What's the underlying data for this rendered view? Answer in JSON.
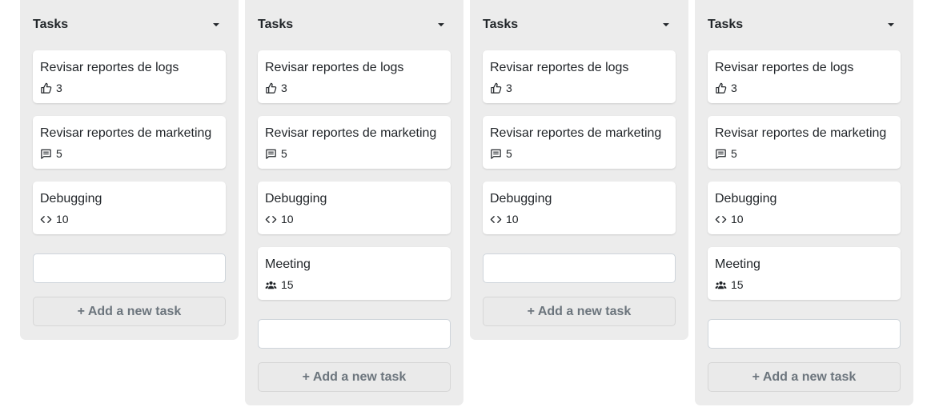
{
  "columns": [
    {
      "title": "Tasks",
      "input_value": "",
      "add_label": "+ Add a new task",
      "cards": [
        {
          "title": "Revisar reportes de logs",
          "icon": "thumbs-up-icon",
          "count": "3"
        },
        {
          "title": "Revisar reportes de marketing",
          "icon": "comment-icon",
          "count": "5"
        },
        {
          "title": "Debugging",
          "icon": "code-icon",
          "count": "10"
        }
      ]
    },
    {
      "title": "Tasks",
      "input_value": "",
      "add_label": "+ Add a new task",
      "cards": [
        {
          "title": "Revisar reportes de logs",
          "icon": "thumbs-up-icon",
          "count": "3"
        },
        {
          "title": "Revisar reportes de marketing",
          "icon": "comment-icon",
          "count": "5"
        },
        {
          "title": "Debugging",
          "icon": "code-icon",
          "count": "10"
        },
        {
          "title": "Meeting",
          "icon": "people-icon",
          "count": "15"
        }
      ]
    },
    {
      "title": "Tasks",
      "input_value": "",
      "add_label": "+ Add a new task",
      "cards": [
        {
          "title": "Revisar reportes de logs",
          "icon": "thumbs-up-icon",
          "count": "3"
        },
        {
          "title": "Revisar reportes de marketing",
          "icon": "comment-icon",
          "count": "5"
        },
        {
          "title": "Debugging",
          "icon": "code-icon",
          "count": "10"
        }
      ]
    },
    {
      "title": "Tasks",
      "input_value": "",
      "add_label": "+ Add a new task",
      "cards": [
        {
          "title": "Revisar reportes de logs",
          "icon": "thumbs-up-icon",
          "count": "3"
        },
        {
          "title": "Revisar reportes de marketing",
          "icon": "comment-icon",
          "count": "5"
        },
        {
          "title": "Debugging",
          "icon": "code-icon",
          "count": "10"
        },
        {
          "title": "Meeting",
          "icon": "people-icon",
          "count": "15"
        }
      ]
    }
  ]
}
